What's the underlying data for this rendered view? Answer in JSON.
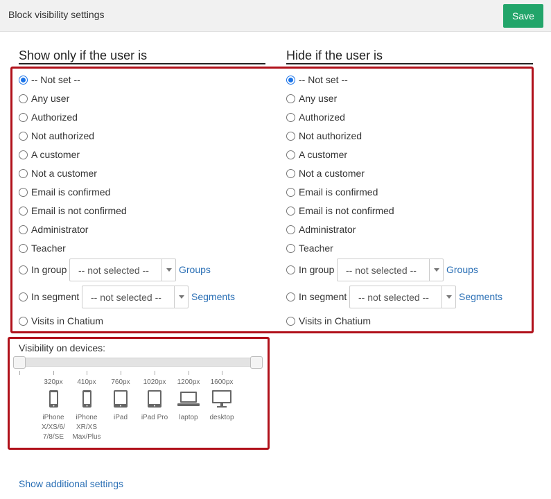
{
  "header": {
    "title": "Block visibility settings",
    "save_label": "Save"
  },
  "show_column": {
    "title": "Show only if the user is",
    "options": [
      "-- Not set --",
      "Any user",
      "Authorized",
      "Not authorized",
      "A customer",
      "Not a customer",
      "Email is confirmed",
      "Email is not confirmed",
      "Administrator",
      "Teacher"
    ],
    "group_label": "In group",
    "group_select": "-- not selected --",
    "groups_link": "Groups",
    "segment_label": "In segment",
    "segment_select": "-- not selected --",
    "segments_link": "Segments",
    "visits_label": "Visits in Chatium",
    "selected_index": 0
  },
  "hide_column": {
    "title": "Hide if the user is",
    "options": [
      "-- Not set --",
      "Any user",
      "Authorized",
      "Not authorized",
      "A customer",
      "Not a customer",
      "Email is confirmed",
      "Email is not confirmed",
      "Administrator",
      "Teacher"
    ],
    "group_label": "In group",
    "group_select": "-- not selected --",
    "groups_link": "Groups",
    "segment_label": "In segment",
    "segment_select": "-- not selected --",
    "segments_link": "Segments",
    "visits_label": "Visits in Chatium",
    "selected_index": 0
  },
  "devices": {
    "label": "Visibility on devices:",
    "items": [
      {
        "px": "320px",
        "name": "iPhone X/XS/6/ 7/8/SE",
        "icon": "phone-icon"
      },
      {
        "px": "410px",
        "name": "iPhone XR/XS Max/Plus",
        "icon": "phone-icon"
      },
      {
        "px": "760px",
        "name": "iPad",
        "icon": "tablet-icon"
      },
      {
        "px": "1020px",
        "name": "iPad Pro",
        "icon": "tablet-icon"
      },
      {
        "px": "1200px",
        "name": "laptop",
        "icon": "laptop-icon"
      },
      {
        "px": "1600px",
        "name": "desktop",
        "icon": "desktop-icon"
      }
    ],
    "range_min_index": 0,
    "range_max_index": 6
  },
  "footer": {
    "additional_link": "Show additional settings"
  },
  "colors": {
    "accent": "#22a56a",
    "highlight_border": "#b0101a",
    "link": "#2a6fb5"
  }
}
